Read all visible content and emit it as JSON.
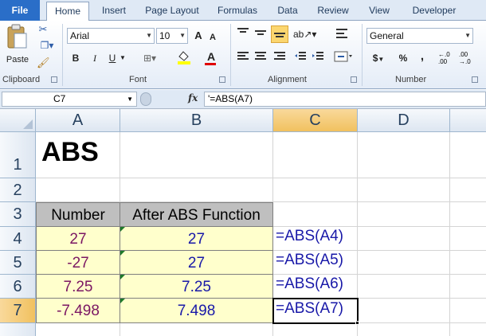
{
  "ribbon_tabs": [
    "File",
    "Home",
    "Insert",
    "Page Layout",
    "Formulas",
    "Data",
    "Review",
    "View",
    "Developer"
  ],
  "active_tab": "Home",
  "clipboard": {
    "paste_label": "Paste",
    "group_label": "Clipboard"
  },
  "font": {
    "name": "Arial",
    "size": "10",
    "group_label": "Font",
    "bold": "B",
    "italic": "I",
    "underline": "U",
    "grow": "A",
    "shrink": "A",
    "color_glyph": "A"
  },
  "alignment": {
    "group_label": "Alignment"
  },
  "number": {
    "format": "General",
    "group_label": "Number",
    "currency": "$",
    "percent": "%",
    "comma": ","
  },
  "formula_bar": {
    "cell_ref": "C7",
    "fx": "fx",
    "formula": "'=ABS(A7)"
  },
  "columns": [
    "A",
    "B",
    "C",
    "D"
  ],
  "selected_column": "C",
  "rows": [
    "1",
    "2",
    "3",
    "4",
    "5",
    "6",
    "7"
  ],
  "selected_row": "7",
  "title": "ABS",
  "table": {
    "headers": [
      "Number",
      "After ABS Function"
    ],
    "rows": [
      {
        "number": "27",
        "result": "27",
        "formula": "=ABS(A4)"
      },
      {
        "number": "-27",
        "result": "27",
        "formula": "=ABS(A5)"
      },
      {
        "number": "7.25",
        "result": "7.25",
        "formula": "=ABS(A6)"
      },
      {
        "number": "-7.498",
        "result": "7.498",
        "formula": "=ABS(A7)"
      }
    ]
  },
  "colors": {
    "number_text": "#7b1763",
    "result_text": "#1818a8",
    "formula_text": "#1818a8",
    "accent": "#f1c15f",
    "file_tab": "#2a6ec8"
  }
}
